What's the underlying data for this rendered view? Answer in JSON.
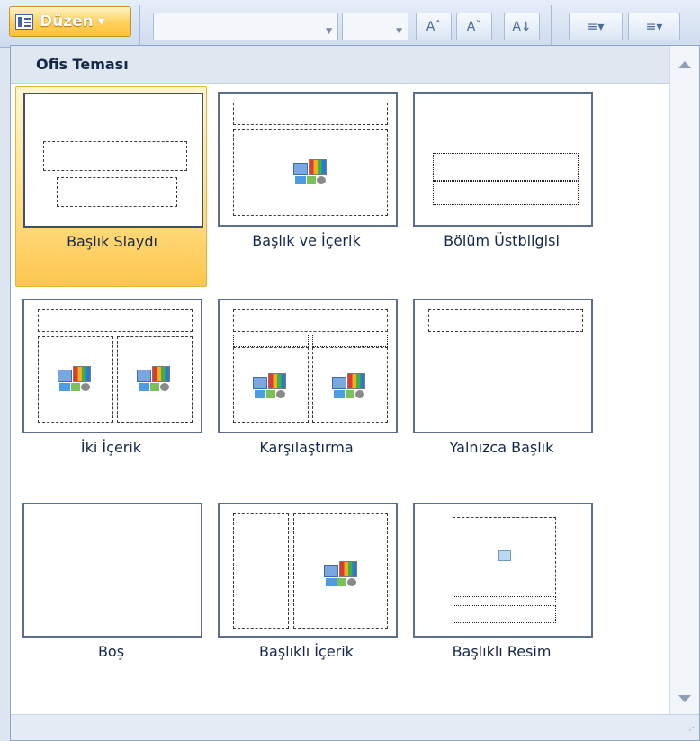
{
  "ribbon": {
    "layout_button": {
      "label": "Düzen",
      "icon": "layout-icon"
    },
    "font_buttons": [
      "Aˆ",
      "Aˇ",
      "A↓"
    ],
    "list_buttons": [
      "≡▾",
      "≡▾"
    ]
  },
  "gallery": {
    "title": "Ofis Teması",
    "layouts": [
      {
        "label": "Başlık Slaydı",
        "selected": true
      },
      {
        "label": "Başlık ve İçerik",
        "selected": false
      },
      {
        "label": "Bölüm Üstbilgisi",
        "selected": false
      },
      {
        "label": "İki İçerik",
        "selected": false
      },
      {
        "label": "Karşılaştırma",
        "selected": false
      },
      {
        "label": "Yalnızca Başlık",
        "selected": false
      },
      {
        "label": "Boş",
        "selected": false
      },
      {
        "label": "Başlıklı İçerik",
        "selected": false
      },
      {
        "label": "Başlıklı Resim",
        "selected": false
      }
    ]
  },
  "colors": {
    "selected_fill": "#ffd978",
    "selected_border": "#e5b53f",
    "header_bg": "#dfe7f1",
    "text": "#15284b"
  }
}
